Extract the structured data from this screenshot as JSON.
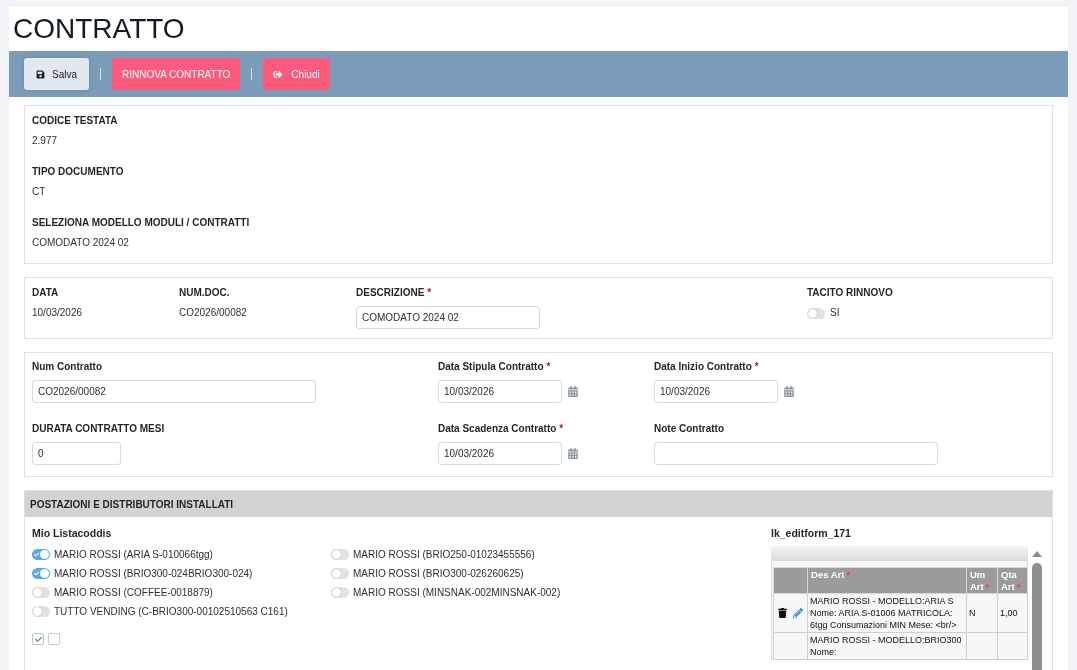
{
  "title": "CONTRATTO",
  "toolbar": {
    "buttons": [
      {
        "kind": "save",
        "label": "Salva"
      },
      {
        "kind": "action",
        "label": "RINNOVA CONTRATTO"
      },
      {
        "kind": "exit",
        "label": "Chiudi"
      }
    ]
  },
  "header_section": {
    "fields": [
      {
        "label": "CODICE TESTATA",
        "value": "2.977"
      },
      {
        "label": "TIPO DOCUMENTO",
        "value": "CT"
      },
      {
        "label": "SELEZIONA MODELLO MODULI / CONTRATTI",
        "value": "COMODATO 2024 02"
      }
    ]
  },
  "document_section": {
    "fields": [
      {
        "kind": "static",
        "label": "DATA",
        "value": "10/03/2026"
      },
      {
        "kind": "static",
        "label": "NUM.DOC.",
        "value": "CO2026/00082"
      },
      {
        "kind": "text",
        "label": "DESCRIZIONE",
        "required_mark": "*",
        "value": "COMODATO 2024 02"
      },
      {
        "kind": "toggle",
        "label": "TACITO RINNOVO",
        "option": "SI",
        "on": false
      }
    ]
  },
  "contract_section": {
    "rows": [
      [
        {
          "kind": "text",
          "label": "Num Contratto",
          "value": "CO2026/00082"
        },
        {
          "kind": "date",
          "label": "Data Stipula Contratto",
          "required_mark": "*",
          "value": "10/03/2026"
        },
        {
          "kind": "date",
          "label": "Data Inizio Contratto",
          "required_mark": "*",
          "value": "10/03/2026"
        }
      ],
      [
        {
          "kind": "number",
          "label": "DURATA CONTRATTO MESI",
          "value": "0"
        },
        {
          "kind": "date",
          "label": "Data Scadenza Contratto",
          "required_mark": "*",
          "value": "10/03/2026"
        },
        {
          "kind": "text",
          "label": "Note Contratto"
        }
      ]
    ]
  },
  "installations": {
    "title": "POSTAZIONI E DISTRIBUTORI INSTALLATI",
    "list_title": "Mio Listacoddis",
    "items": [
      {
        "label": "MARIO ROSSI (ARIA S-010066tgg)",
        "on": true
      },
      {
        "label": "MARIO ROSSI (BRIO300-024BRIO300-024)",
        "on": true
      },
      {
        "label": "MARIO ROSSI (COFFEE-0018879)",
        "on": false
      },
      {
        "label": "TUTTO VENDING (C-BRIO300-00102510563 C161)",
        "on": false
      },
      {
        "label": "MARIO ROSSI (BRIO250-01023455556)",
        "on": false
      },
      {
        "label": "MARIO ROSSI (BRIO300-026260625)",
        "on": false
      },
      {
        "label": "MARIO ROSSI (MINSNAK-002MINSNAK-002)",
        "on": false
      }
    ],
    "checkboxes": [
      {
        "checked": true
      },
      {
        "checked": false
      }
    ],
    "grid": {
      "title": "lk_editform_171",
      "columns": [
        {
          "label": "Des Art",
          "required_mark": "*"
        },
        {
          "label": "Um Art",
          "required_mark": "*"
        },
        {
          "label": "Qta Art",
          "required_mark": "*"
        }
      ],
      "rows": [
        {
          "actions": true,
          "cells": [
            "MARIO ROSSI - MODELLO:ARIA S Nome: ARIA S-01006 MATRICOLA: 6tgg Consumazioni MIN Mese: <br/>",
            "N",
            "1,00"
          ]
        },
        {
          "actions": false,
          "cells": [
            "MARIO ROSSI - MODELLO:BRIO300 Nome:"
          ]
        }
      ]
    }
  }
}
